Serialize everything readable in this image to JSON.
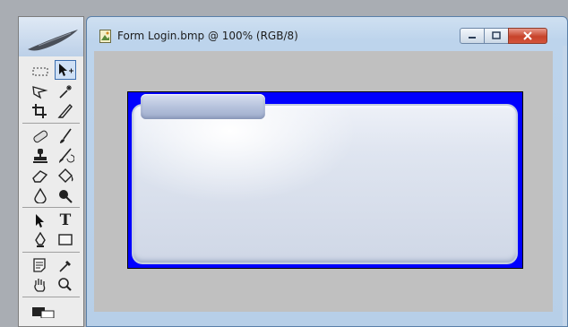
{
  "document": {
    "title": "Form Login.bmp @ 100% (RGB/8)"
  },
  "toolbox": {
    "tools": [
      "marquee-tool-icon",
      "move-tool-icon",
      "lasso-tool-icon",
      "magic-wand-icon",
      "crop-tool-icon",
      "slice-tool-icon",
      "healing-brush-icon",
      "brush-tool-icon",
      "clone-stamp-icon",
      "history-brush-icon",
      "eraser-tool-icon",
      "paint-bucket-icon",
      "blur-tool-icon",
      "dodge-tool-icon",
      "path-selection-icon",
      "type-tool-icon",
      "pen-tool-icon",
      "rectangle-tool-icon",
      "notes-tool-icon",
      "eyedropper-icon",
      "hand-tool-icon",
      "zoom-tool-icon"
    ],
    "type_tool_glyph": "T"
  },
  "colors": {
    "canvas_background": "#0000ff",
    "workspace": "#c0c0c0",
    "close_button": "#c7432b"
  }
}
